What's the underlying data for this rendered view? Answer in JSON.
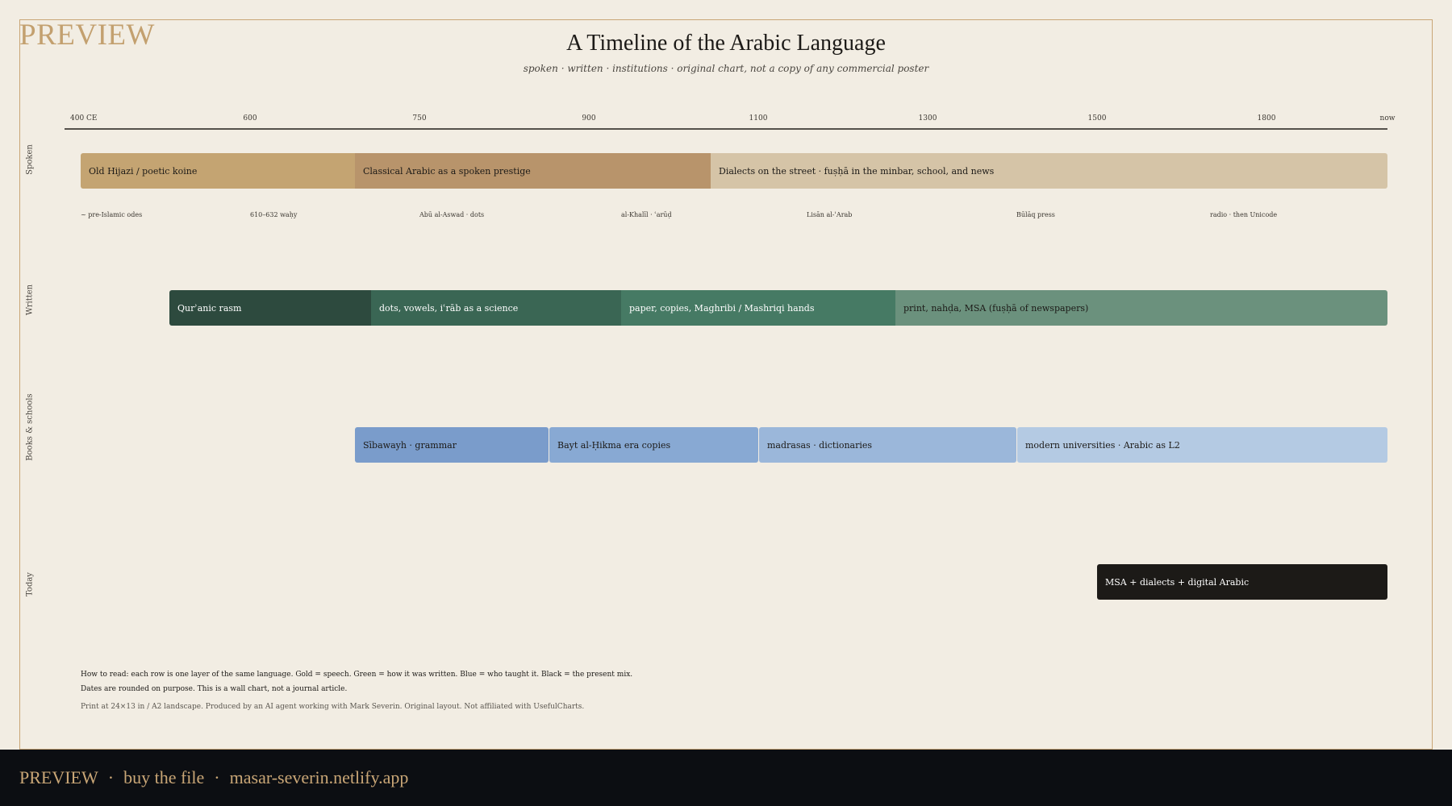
{
  "watermark": "PREVIEW",
  "title": "A Timeline of the Arabic Language",
  "subtitle": "spoken · written · institutions · original chart, not a copy of any commercial poster",
  "axis": {
    "ticks": [
      "400 CE",
      "600",
      "750",
      "900",
      "1100",
      "1300",
      "1500",
      "1800",
      "now"
    ]
  },
  "rows": {
    "spoken": {
      "label": "Spoken",
      "bands": [
        {
          "label": "Old Hijazi / poetic koine",
          "color": "#c4a472",
          "text_color": "#1c1a17"
        },
        {
          "label": "Classical Arabic as a spoken prestige",
          "color": "#b8946b",
          "text_color": "#1c1a17"
        },
        {
          "label": "Dialects on the street · fuṣḥā in the minbar, school, and news",
          "color": "#d5c4a7",
          "text_color": "#1c1a17"
        }
      ],
      "milestones": [
        "~ pre-Islamic odes",
        "610–632 waḥy",
        "Abū al-Aswad · dots",
        "al-Khalīl · ʿarūḍ",
        "Lisān al-ʿArab",
        "Būlāq press",
        "radio · then Unicode"
      ]
    },
    "written": {
      "label": "Written",
      "bands": [
        {
          "label": "Qurʾanic rasm",
          "color": "#2d4a3e",
          "text_color": "#ffffff"
        },
        {
          "label": "dots, vowels, iʿrāb as a science",
          "color": "#3a6654",
          "text_color": "#ffffff"
        },
        {
          "label": "paper, copies, Maghribi / Mashriqi hands",
          "color": "#467a64",
          "text_color": "#ffffff"
        },
        {
          "label": "print, nahḍa, MSA (fuṣḥā of newspapers)",
          "color": "#6b917d",
          "text_color": "#1c1a17"
        }
      ]
    },
    "schools": {
      "label": "Books & schools",
      "bands": [
        {
          "label": "Sībawayh · grammar",
          "color": "#7a9ccb",
          "text_color": "#1c1a17"
        },
        {
          "label": "Bayt al-Ḥikma era copies",
          "color": "#88a9d3",
          "text_color": "#1c1a17"
        },
        {
          "label": "madrasas · dictionaries",
          "color": "#9bb7da",
          "text_color": "#1c1a17"
        },
        {
          "label": "modern universities · Arabic as L2",
          "color": "#b4cae3",
          "text_color": "#1c1a17"
        }
      ]
    },
    "today": {
      "label": "Today",
      "bands": [
        {
          "label": "MSA + dialects + digital Arabic",
          "color": "#1c1a17",
          "text_color": "#ffffff"
        }
      ]
    }
  },
  "notes": {
    "line1": "How to read: each row is one layer of the same language. Gold = speech. Green = how it was written. Blue = who taught it. Black = the present mix.",
    "line2": "Dates are rounded on purpose. This is a wall chart, not a journal article.",
    "line3": "Print at 24×13 in / A2 landscape. Produced by an AI agent working with Mark Severin. Original layout. Not affiliated with UsefulCharts."
  },
  "footer": {
    "preview": "PREVIEW",
    "sep": "·",
    "buy": "buy the file",
    "site": "masar-severin.netlify.app"
  }
}
